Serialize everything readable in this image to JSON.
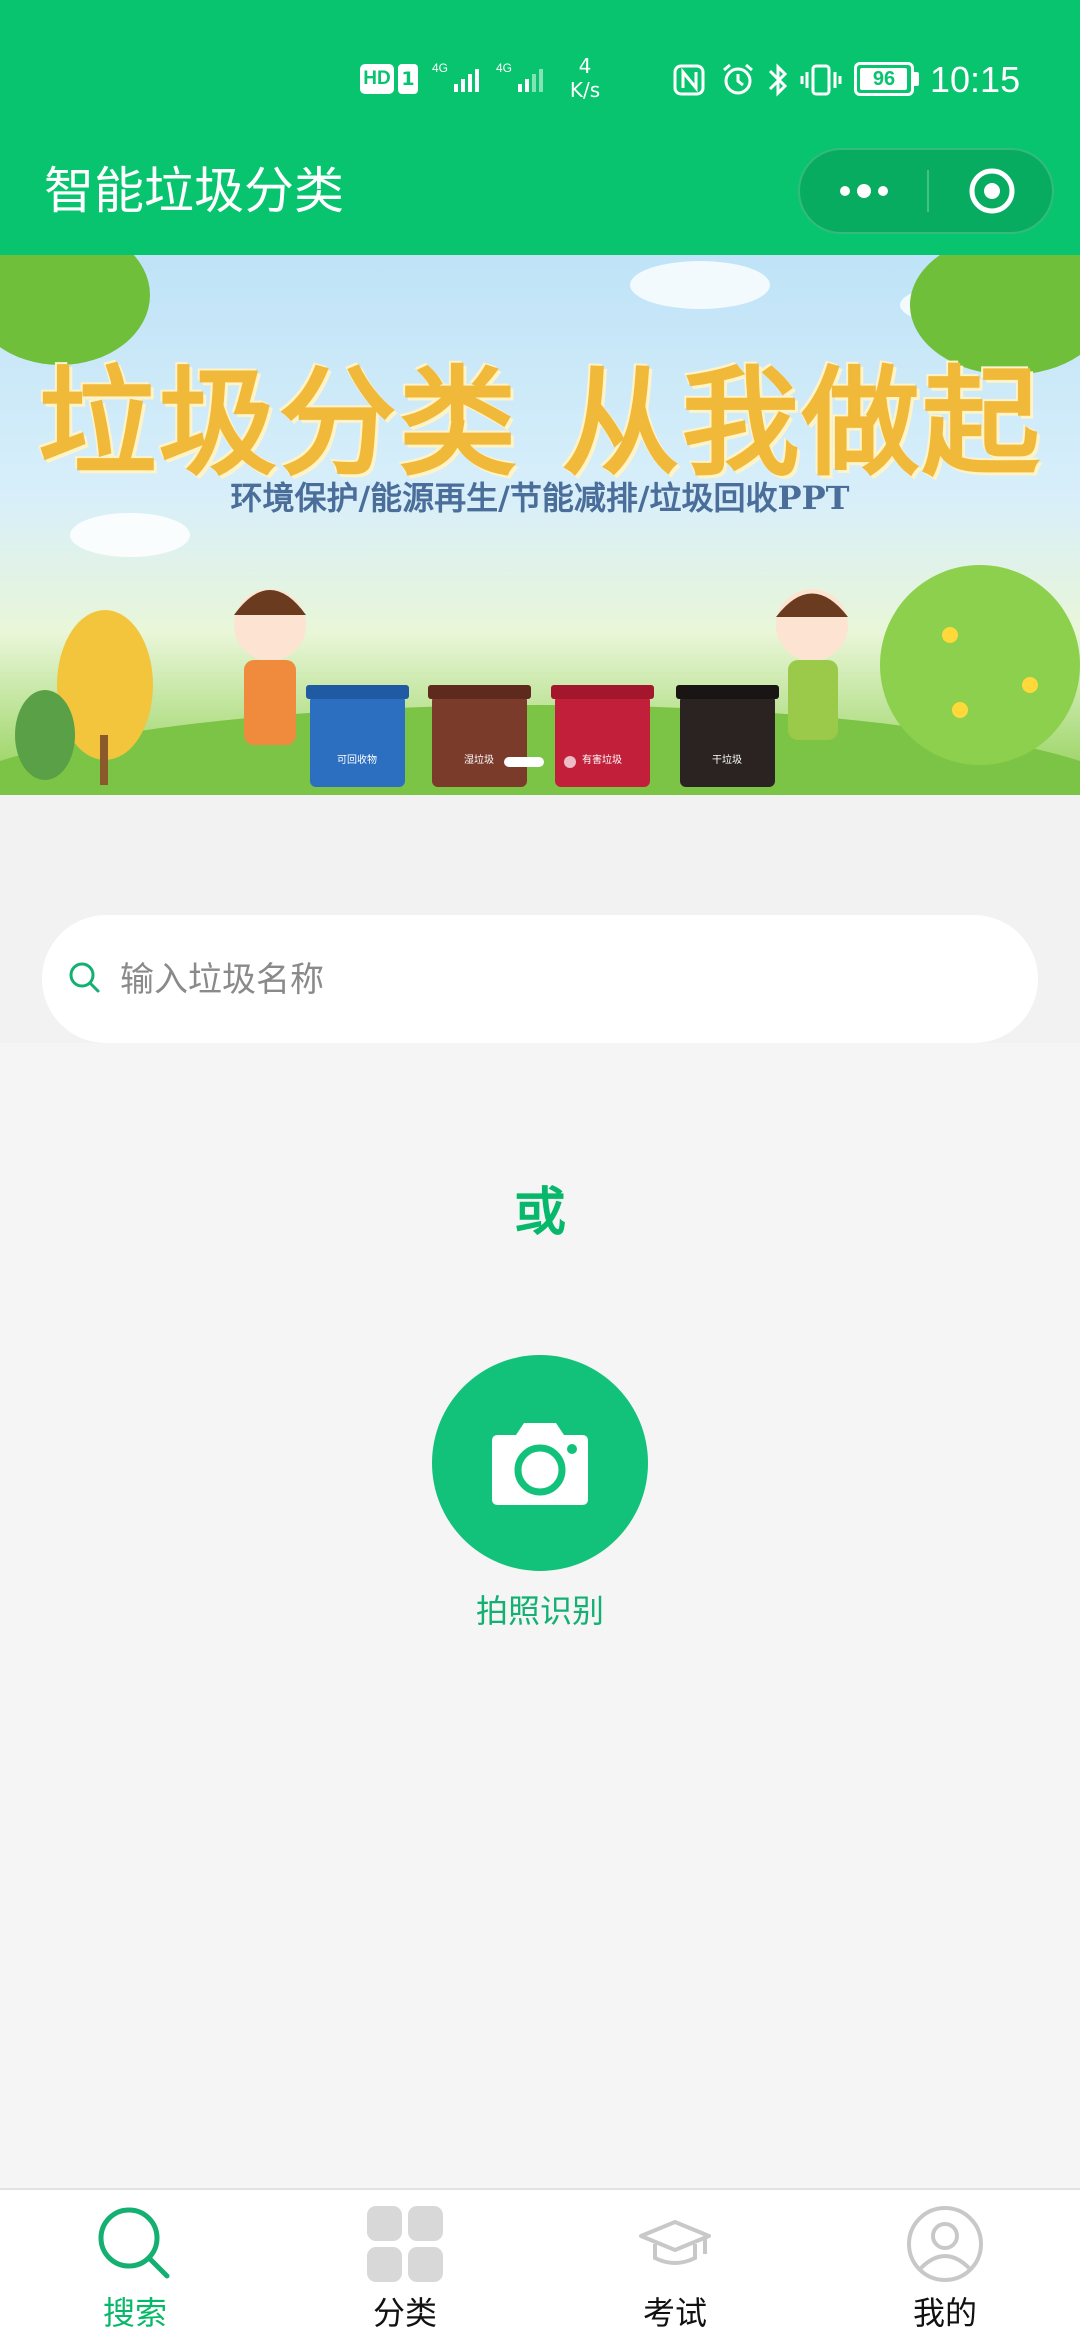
{
  "status_bar": {
    "network_badge": "HD",
    "sim_badge": "1",
    "signal1_label": "4G",
    "signal2_label": "4G",
    "speed_value": "4",
    "speed_unit": "K/s",
    "battery_level": "96",
    "time": "10:15",
    "icons": [
      "nfc-icon",
      "alarm-icon",
      "bluetooth-icon",
      "vibrate-icon",
      "battery-icon"
    ]
  },
  "header": {
    "title": "智能垃圾分类",
    "capsule": [
      "more-icon",
      "close-miniprogram-icon"
    ]
  },
  "banner": {
    "headline": "垃圾分类 从我做起",
    "subline": "环境保护/能源再生/节能减排/垃圾回收PPT",
    "bin_labels": [
      "可回收物",
      "湿垃圾",
      "有害垃圾",
      "干垃圾"
    ],
    "bin_colors": [
      "#2c6fc0",
      "#7a3b2b",
      "#c2203a",
      "#2a2322"
    ],
    "slide_count": 2,
    "active_slide": 1
  },
  "search": {
    "placeholder": "输入垃圾名称",
    "icon": "search-icon"
  },
  "or_text": "或",
  "camera": {
    "label": "拍照识别",
    "icon": "camera-icon"
  },
  "tabs": [
    {
      "label": "搜索",
      "icon": "search-icon",
      "active": true
    },
    {
      "label": "分类",
      "icon": "grid-icon",
      "active": false
    },
    {
      "label": "考试",
      "icon": "graduation-cap-icon",
      "active": false
    },
    {
      "label": "我的",
      "icon": "user-icon",
      "active": false
    }
  ],
  "colors": {
    "primary": "#08c46f",
    "background": "#f5f5f5",
    "tab_inactive_icon": "#d8d8d8"
  }
}
